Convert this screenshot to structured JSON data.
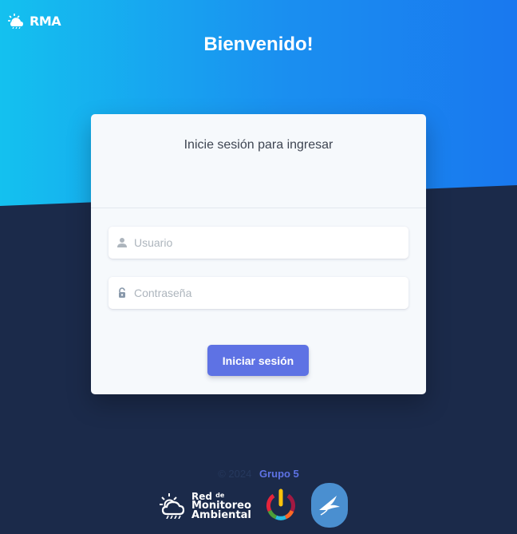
{
  "brand": {
    "logo_text": "RMA",
    "logo_icon": "sun-cloud-icon"
  },
  "header": {
    "welcome": "Bienvenido!"
  },
  "login": {
    "title": "Inicie sesión para ingresar",
    "username": {
      "placeholder": "Usuario",
      "value": "",
      "icon": "user-icon"
    },
    "password": {
      "placeholder": "Contraseña",
      "value": "",
      "icon": "lock-icon"
    },
    "submit_label": "Iniciar sesión"
  },
  "footer": {
    "copyright": "© 2024",
    "group_link": "Grupo 5",
    "logos": {
      "network_line1": "Red",
      "network_line1_small": "de",
      "network_line2": "Monitoreo",
      "network_line3": "Ambiental"
    }
  },
  "colors": {
    "hero_start": "#14c1ef",
    "hero_end": "#1978ef",
    "background": "#1b2a4a",
    "card": "#f6f9fc",
    "primary": "#5e72e4"
  }
}
